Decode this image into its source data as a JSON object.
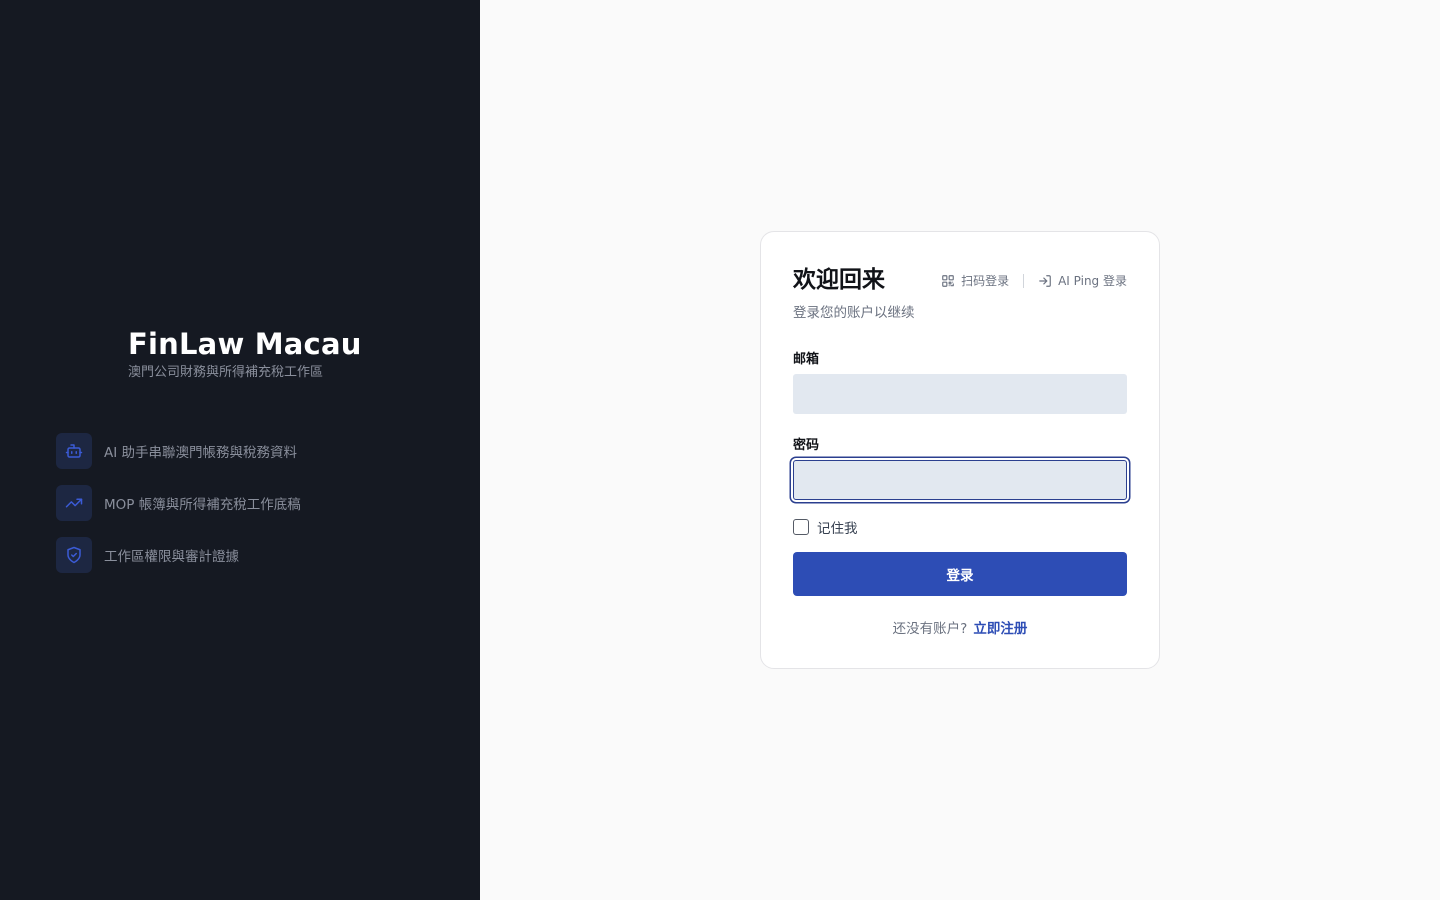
{
  "brand": {
    "title": "FinLaw Macau",
    "subtitle": "澳門公司財務與所得補充稅工作區"
  },
  "features": [
    {
      "icon": "robot-icon",
      "label": "AI 助手串聯澳門帳務與稅務資料"
    },
    {
      "icon": "trending-up-icon",
      "label": "MOP 帳簿與所得補充稅工作底稿"
    },
    {
      "icon": "shield-check-icon",
      "label": "工作區權限與審計證據"
    }
  ],
  "login": {
    "title": "欢迎回来",
    "subtitle": "登录您的账户以继续",
    "qr_login": "扫码登录",
    "ai_ping_login": "AI Ping 登录",
    "email_label": "邮箱",
    "email_value": "",
    "password_label": "密码",
    "password_value": "",
    "remember_label": "记住我",
    "remember_checked": false,
    "submit_label": "登录",
    "no_account_text": "还没有账户?",
    "register_link": "立即注册"
  },
  "colors": {
    "left_panel_bg": "#151922",
    "accent": "#2d4db5",
    "input_bg": "#e2e8f0",
    "page_bg": "#fafafa"
  }
}
